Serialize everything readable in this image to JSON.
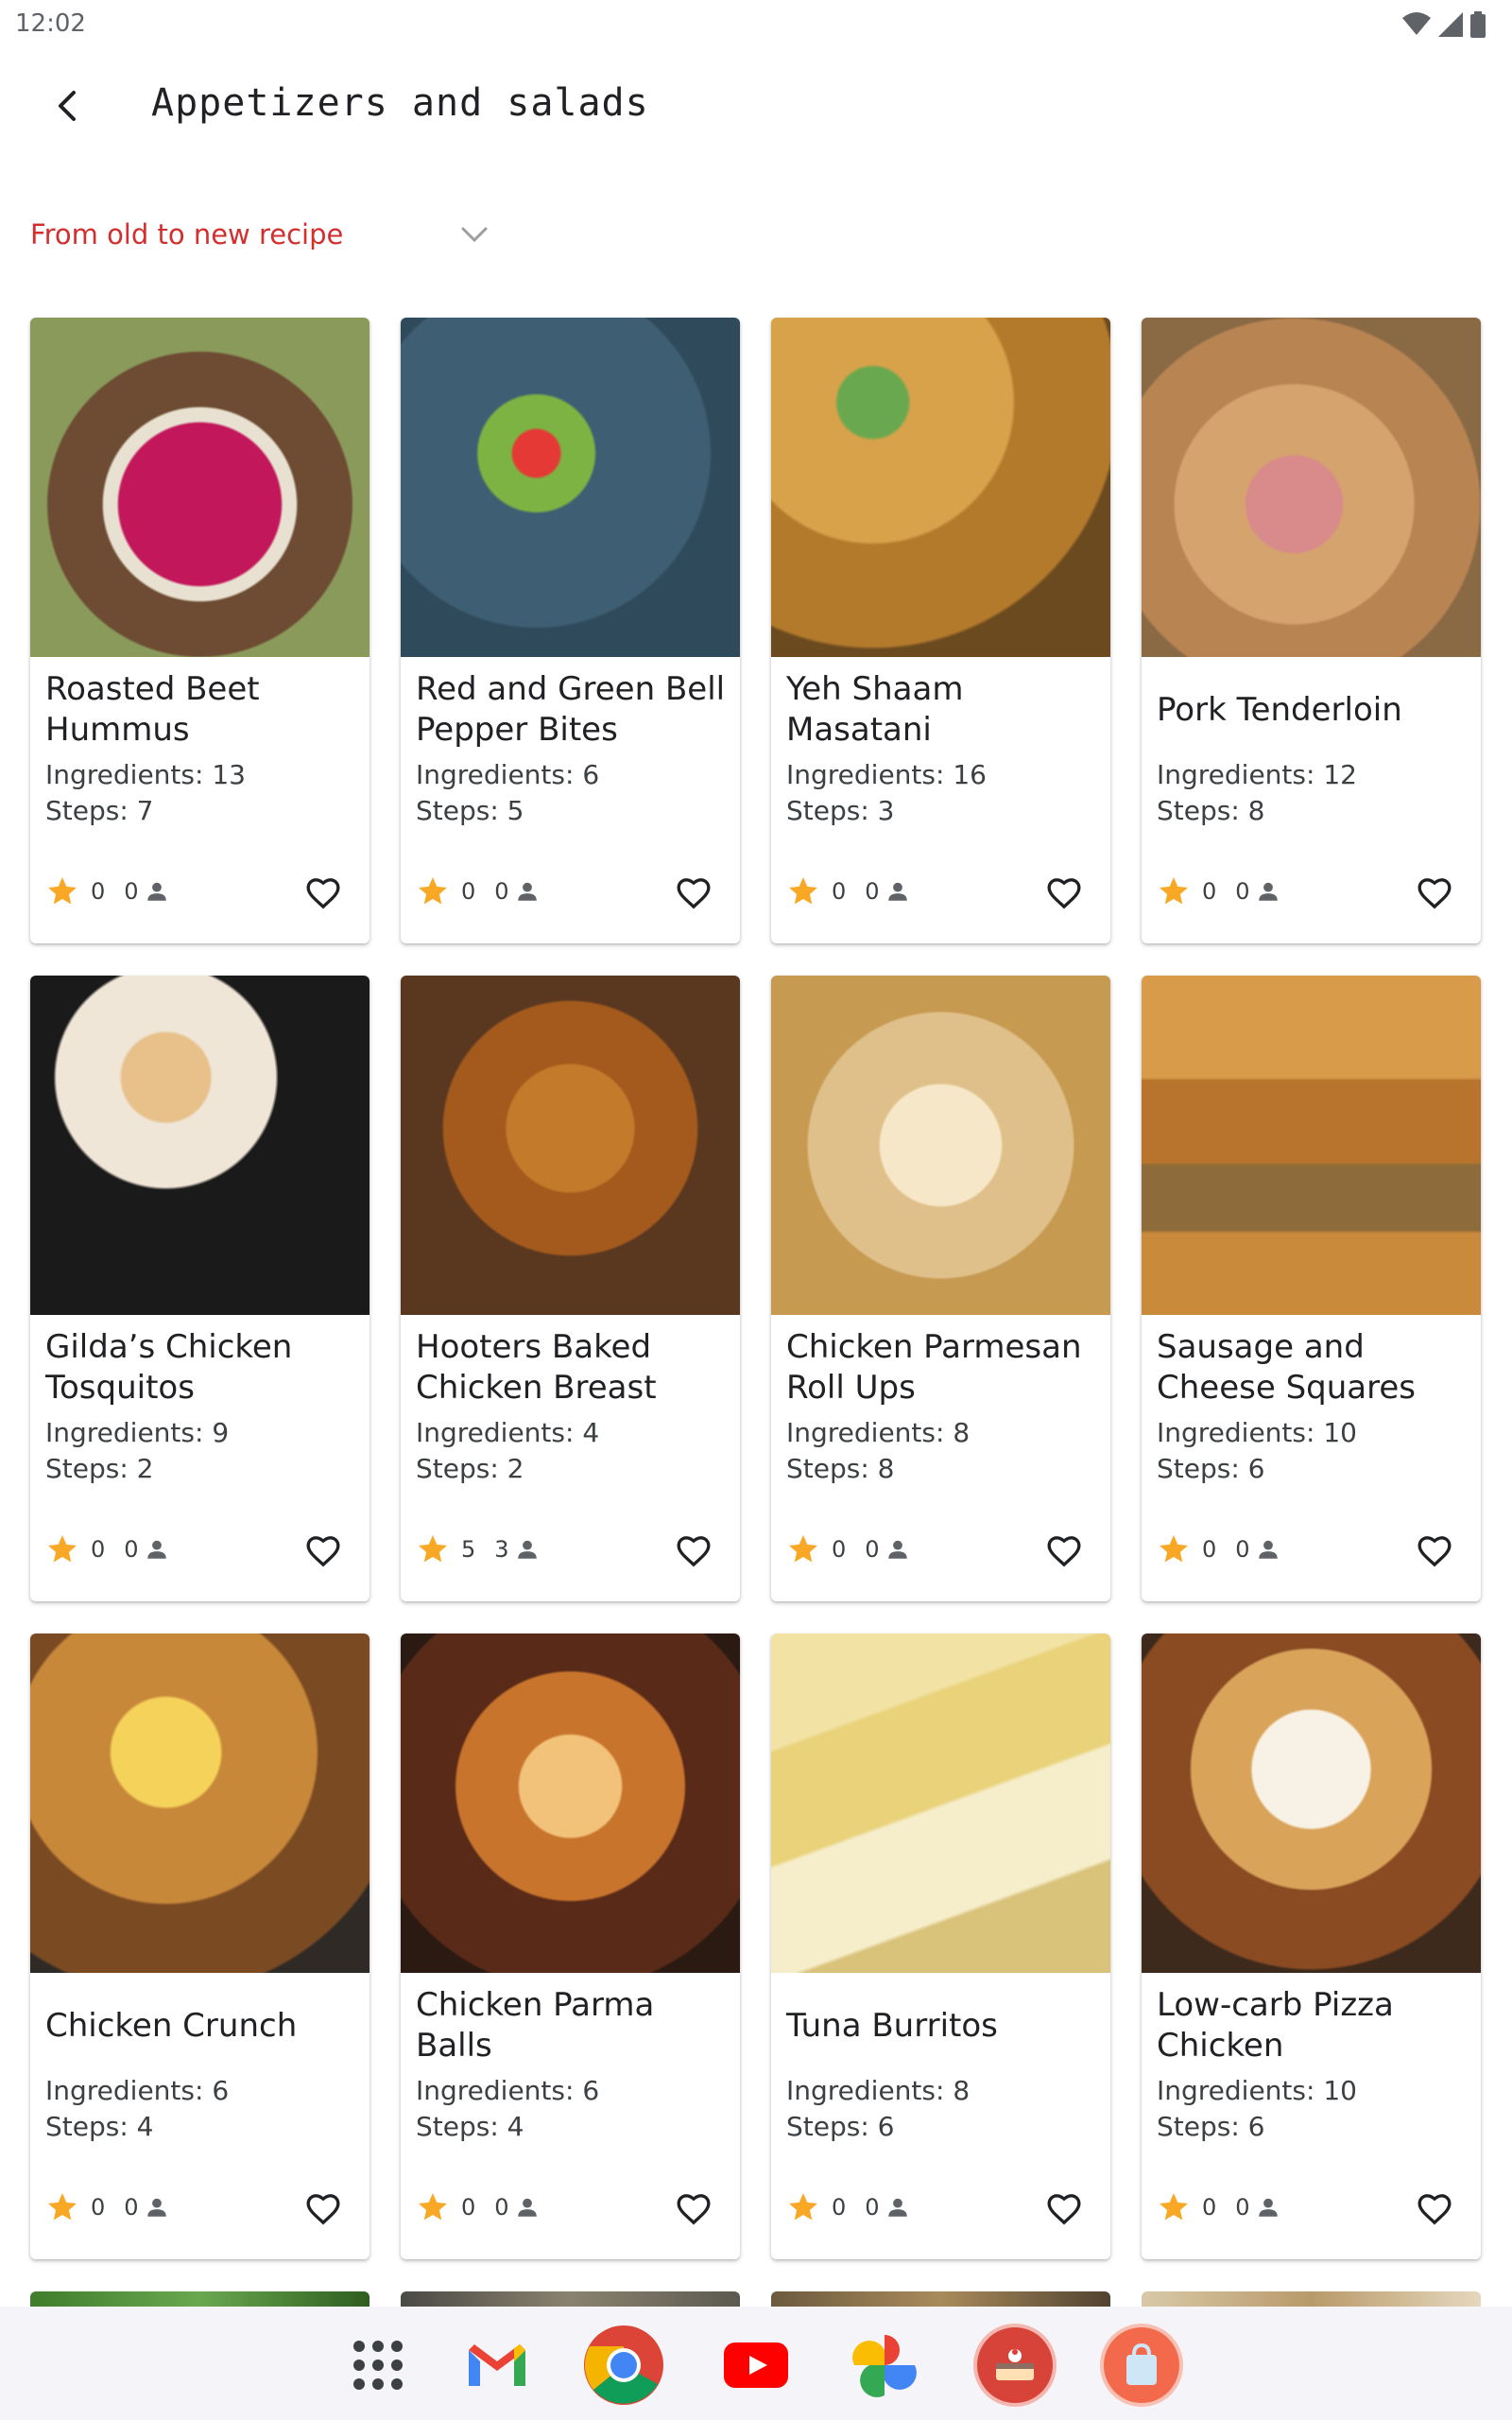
{
  "status": {
    "time": "12:02"
  },
  "header": {
    "title": "Appetizers and salads",
    "back_icon": "arrow-back-icon"
  },
  "sort": {
    "selected": "From old to new recipe",
    "accent": "#d32f2f"
  },
  "labels": {
    "ingredients": "Ingredients: ",
    "steps": "Steps: "
  },
  "recipes": [
    {
      "title": "Roasted Beet Hummus",
      "ingredients": "Ingredients: 13",
      "steps": "Steps: 7",
      "rating": "0",
      "count": "0"
    },
    {
      "title": "Red and Green Bell Pepper Bites",
      "ingredients": "Ingredients: 6",
      "steps": "Steps: 5",
      "rating": "0",
      "count": "0"
    },
    {
      "title": "Yeh Shaam Masatani",
      "ingredients": "Ingredients: 16",
      "steps": "Steps: 3",
      "rating": "0",
      "count": "0"
    },
    {
      "title": "Pork Tenderloin",
      "ingredients": "Ingredients: 12",
      "steps": "Steps: 8",
      "rating": "0",
      "count": "0"
    },
    {
      "title": "Gilda’s Chicken Tosquitos",
      "ingredients": "Ingredients: 9",
      "steps": "Steps: 2",
      "rating": "0",
      "count": "0"
    },
    {
      "title": "Hooters Baked Chicken Breast",
      "ingredients": "Ingredients: 4",
      "steps": "Steps: 2",
      "rating": "5",
      "count": "3"
    },
    {
      "title": "Chicken Parmesan Roll Ups",
      "ingredients": "Ingredients: 8",
      "steps": "Steps: 8",
      "rating": "0",
      "count": "0"
    },
    {
      "title": "Sausage and Cheese Squares",
      "ingredients": "Ingredients: 10",
      "steps": "Steps: 6",
      "rating": "0",
      "count": "0"
    },
    {
      "title": "Chicken Crunch",
      "ingredients": "Ingredients: 6",
      "steps": "Steps: 4",
      "rating": "0",
      "count": "0"
    },
    {
      "title": "Chicken Parma Balls",
      "ingredients": "Ingredients: 6",
      "steps": "Steps: 4",
      "rating": "0",
      "count": "0"
    },
    {
      "title": "Tuna Burritos",
      "ingredients": "Ingredients: 8",
      "steps": "Steps: 6",
      "rating": "0",
      "count": "0"
    },
    {
      "title": "Low-carb Pizza Chicken",
      "ingredients": "Ingredients: 10",
      "steps": "Steps: 6",
      "rating": "0",
      "count": "0"
    }
  ],
  "colors": {
    "star": "#f9a825",
    "accent": "#d32f2f",
    "text": "#202124"
  },
  "dock": [
    {
      "name": "app-drawer-icon"
    },
    {
      "name": "gmail-icon"
    },
    {
      "name": "chrome-icon"
    },
    {
      "name": "youtube-icon"
    },
    {
      "name": "photos-icon"
    },
    {
      "name": "recipe-app-icon"
    },
    {
      "name": "shopping-app-icon"
    }
  ]
}
